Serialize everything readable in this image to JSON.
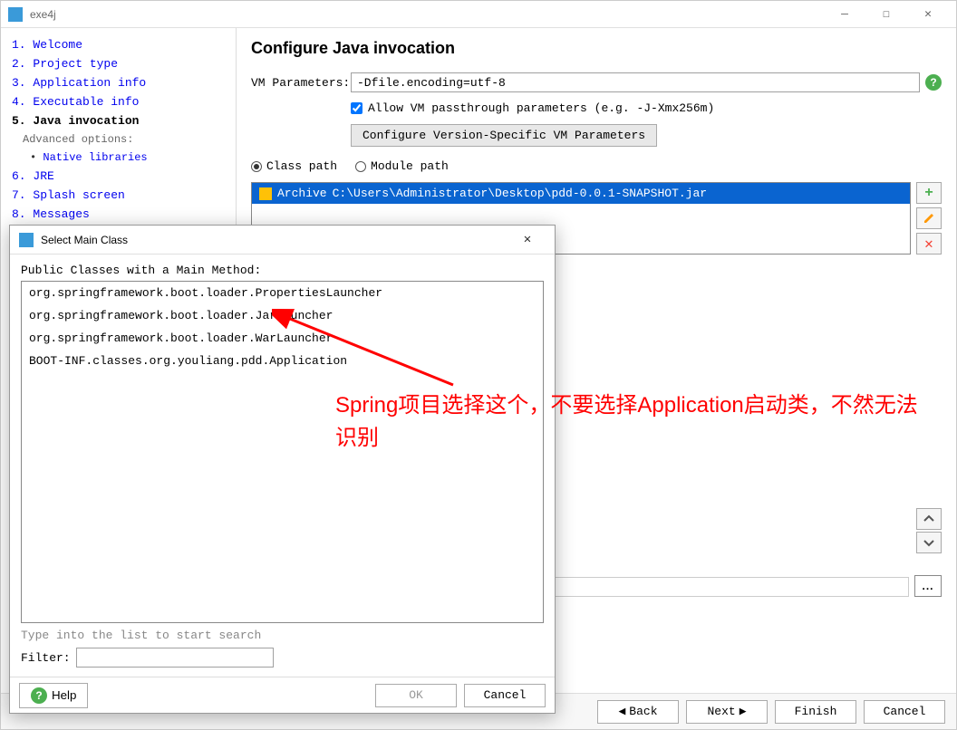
{
  "window": {
    "title": "exe4j"
  },
  "sidebar": {
    "items": [
      {
        "label": "1. Welcome",
        "type": "link"
      },
      {
        "label": "2. Project type",
        "type": "link"
      },
      {
        "label": "3. Application info",
        "type": "link"
      },
      {
        "label": "4. Executable info",
        "type": "link"
      },
      {
        "label": "5. Java invocation",
        "type": "current"
      },
      {
        "label": "Advanced options:",
        "type": "sub"
      },
      {
        "label": "Native libraries",
        "type": "sub-bullet"
      },
      {
        "label": "6. JRE",
        "type": "link"
      },
      {
        "label": "7. Splash screen",
        "type": "link"
      },
      {
        "label": "8. Messages",
        "type": "link"
      }
    ]
  },
  "content": {
    "heading": "Configure Java invocation",
    "vm_params_label": "VM Parameters:",
    "vm_params_value": "-Dfile.encoding=utf-8",
    "allow_passthrough_label": "Allow VM passthrough parameters (e.g. -J-Xmx256m)",
    "allow_passthrough_checked": true,
    "config_version_btn": "Configure Version-Specific VM Parameters",
    "classpath_label": "Class path",
    "modulepath_label": "Module path",
    "archive_label": "Archive",
    "archive_path": "C:\\Users\\Administrator\\Desktop\\pdd-0.0.1-SNAPSHOT.jar"
  },
  "dialog": {
    "title": "Select Main Class",
    "heading": "Public Classes with a Main Method:",
    "classes": [
      "org.springframework.boot.loader.PropertiesLauncher",
      "org.springframework.boot.loader.JarLauncher",
      "org.springframework.boot.loader.WarLauncher",
      "BOOT-INF.classes.org.youliang.pdd.Application"
    ],
    "hint": "Type into the list to start search",
    "filter_label": "Filter:",
    "help_label": "Help",
    "ok_label": "OK",
    "cancel_label": "Cancel"
  },
  "nav": {
    "back": "Back",
    "next": "Next",
    "finish": "Finish",
    "cancel": "Cancel"
  },
  "annotation": {
    "text": "Spring项目选择这个，不要选择Application启动类，不然无法识别"
  }
}
